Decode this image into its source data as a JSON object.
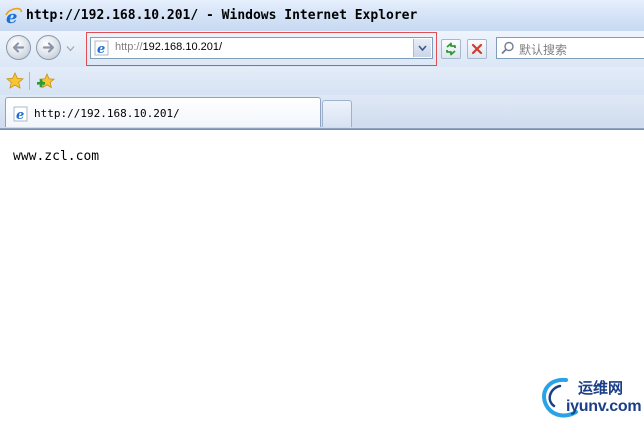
{
  "window": {
    "title": "http://192.168.10.201/ - Windows Internet Explorer",
    "app_icon": "ie-logo-icon"
  },
  "navbar": {
    "back_icon": "back-arrow-icon",
    "forward_icon": "forward-arrow-icon",
    "history_icon": "history-dropdown-icon",
    "address": {
      "scheme": "http://",
      "host": "192.168.10.201/",
      "page_icon": "ie-page-icon",
      "dropdown_icon": "chevron-down-icon"
    },
    "refresh_icon": "refresh-icon",
    "stop_icon": "stop-icon",
    "search": {
      "placeholder": "默认搜索",
      "icon": "search-icon"
    }
  },
  "favorites_bar": {
    "favorites_icon": "favorites-star-icon",
    "add_favorite_icon": "add-favorite-icon"
  },
  "tabs": [
    {
      "label": "http://192.168.10.201/",
      "icon": "ie-page-icon",
      "active": true
    }
  ],
  "new_tab_icon": "new-tab-icon",
  "page": {
    "body_text": "www.zcl.com"
  },
  "watermark": {
    "cn": "运维网",
    "en": "iyunv.com"
  },
  "colors": {
    "highlight_frame": "#e05050",
    "ie_blue": "#1c6fd3",
    "stop_red": "#d23c2c",
    "refresh_green": "#2f9a2f"
  }
}
